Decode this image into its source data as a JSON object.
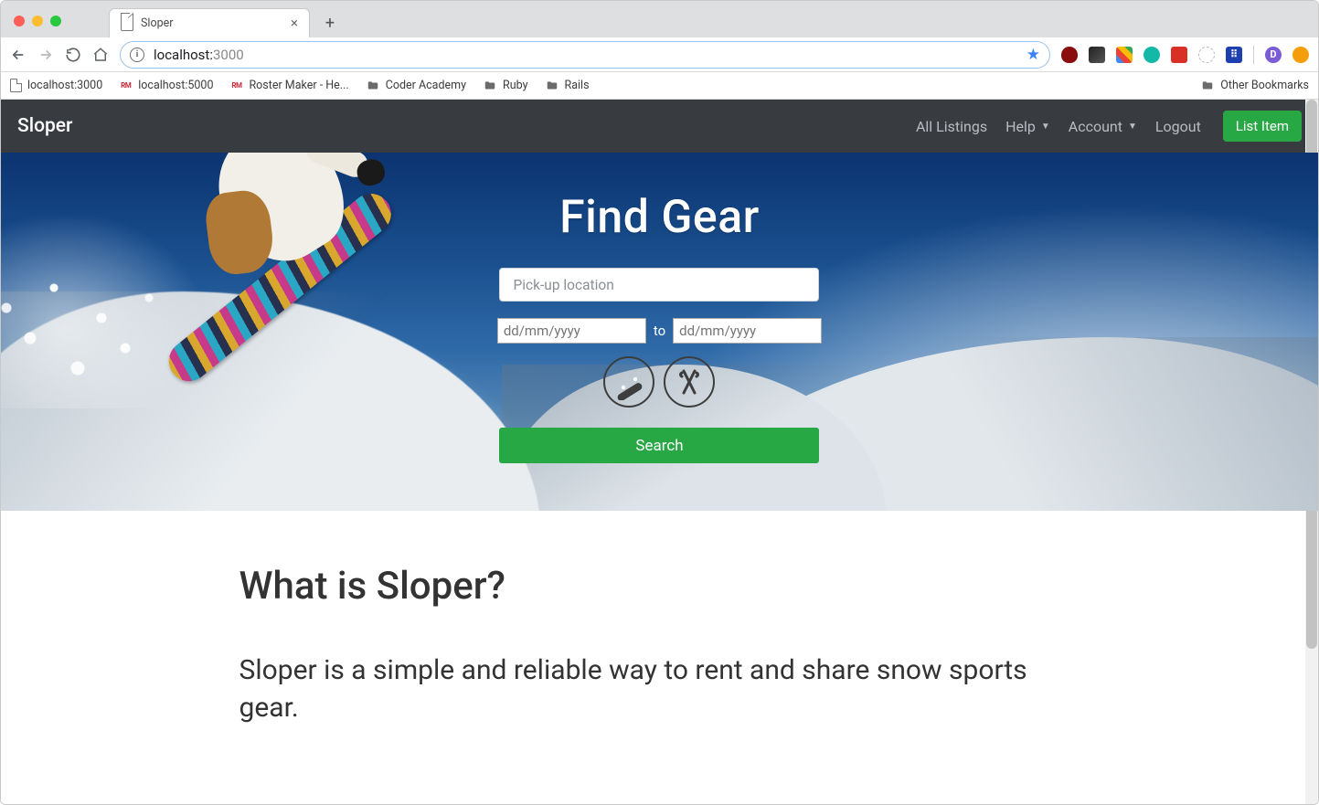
{
  "browser": {
    "tab_title": "Sloper",
    "url_host": "localhost:",
    "url_port": "3000",
    "bookmarks": [
      {
        "icon": "page",
        "label": "localhost:3000"
      },
      {
        "icon": "rm",
        "label": "localhost:5000"
      },
      {
        "icon": "rm",
        "label": "Roster Maker - He..."
      },
      {
        "icon": "folder",
        "label": "Coder Academy"
      },
      {
        "icon": "folder",
        "label": "Ruby"
      },
      {
        "icon": "folder",
        "label": "Rails"
      }
    ],
    "other_bookmarks": "Other Bookmarks"
  },
  "navbar": {
    "brand": "Sloper",
    "links": {
      "all_listings": "All Listings",
      "help": "Help",
      "account": "Account",
      "logout": "Logout"
    },
    "list_item_btn": "List Item"
  },
  "hero": {
    "heading": "Find Gear",
    "location_placeholder": "Pick-up location",
    "date_from_placeholder": "dd/mm/yyyy",
    "date_to_placeholder": "dd/mm/yyyy",
    "date_separator": "to",
    "search_btn": "Search"
  },
  "about": {
    "heading": "What is Sloper?",
    "body": "Sloper is a simple and reliable way to rent and share snow sports gear."
  }
}
